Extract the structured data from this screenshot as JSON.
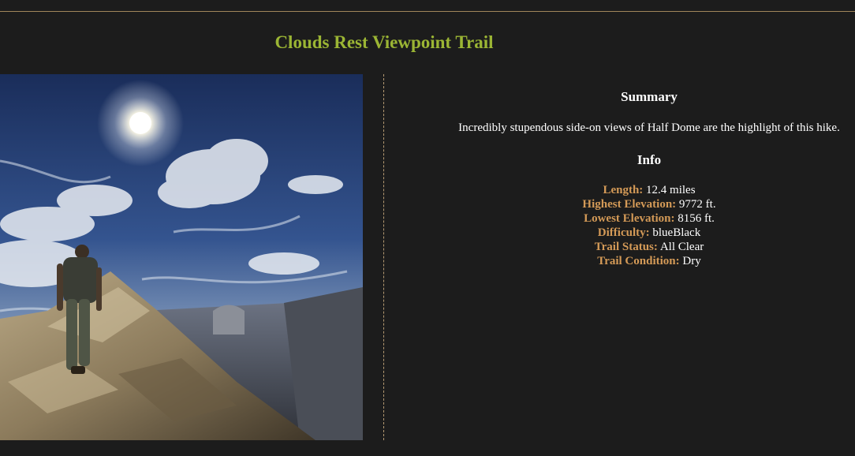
{
  "page": {
    "title": "Clouds Rest Viewpoint Trail"
  },
  "photo": {
    "alt": "Hiker walking along a granite ridge toward Half Dome under a bright sun and swirling clouds"
  },
  "summary": {
    "heading": "Summary",
    "text": "Incredibly stupendous side-on views of Half Dome are the highlight of this hike."
  },
  "info": {
    "heading": "Info",
    "items": [
      {
        "label": "Length:",
        "value": "12.4 miles"
      },
      {
        "label": "Highest Elevation:",
        "value": "9772 ft."
      },
      {
        "label": "Lowest Elevation:",
        "value": "8156 ft."
      },
      {
        "label": "Difficulty:",
        "value": "blueBlack"
      },
      {
        "label": "Trail Status:",
        "value": "All Clear"
      },
      {
        "label": "Trail Condition:",
        "value": "Dry"
      }
    ]
  },
  "colors": {
    "background": "#1c1c1c",
    "title": "#9bb534",
    "label": "#d49a57",
    "rule": "#a0855a"
  }
}
